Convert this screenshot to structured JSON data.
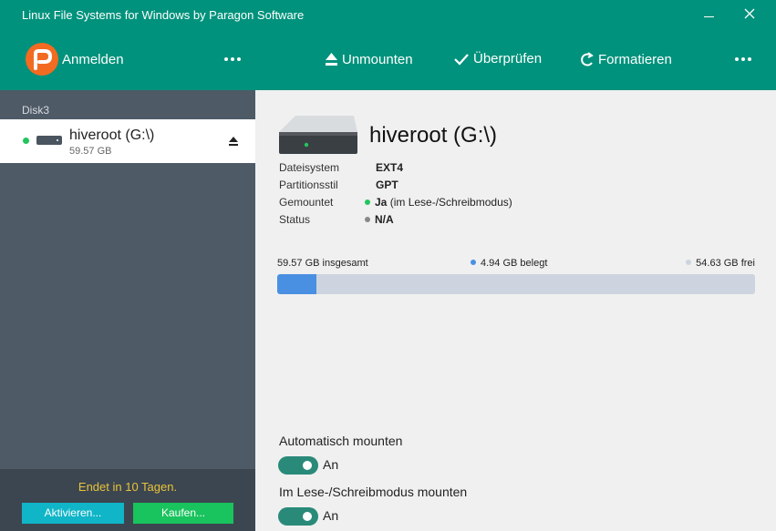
{
  "window": {
    "title": "Linux File Systems for Windows by Paragon Software"
  },
  "toolbar": {
    "login_label": "Anmelden",
    "unmount_label": "Unmounten",
    "check_label": "Überprüfen",
    "format_label": "Formatieren"
  },
  "sidebar": {
    "disk_label": "Disk3",
    "volume": {
      "name": "hiveroot (G:\\)",
      "size": "59.57 GB",
      "status_color": "#22c55e"
    },
    "expiry_text": "Endet in 10 Tagen.",
    "activate_label": "Aktivieren...",
    "buy_label": "Kaufen..."
  },
  "main": {
    "title": "hiveroot (G:\\)",
    "properties": [
      {
        "key": "Dateisystem",
        "value": "EXT4",
        "note": ""
      },
      {
        "key": "Partitionsstil",
        "value": "GPT",
        "note": ""
      },
      {
        "key": "Gemountet",
        "value": "Ja",
        "note": "(im Lese-/Schreibmodus)",
        "dot_color": "#22c55e"
      },
      {
        "key": "Status",
        "value": "N/A",
        "note": "",
        "dot_color": "#888888"
      }
    ],
    "usage": {
      "total_label": "59.57 GB insgesamt",
      "used_label": "4.94 GB belegt",
      "free_label": "54.63 GB frei",
      "used_fraction": 0.083,
      "used_color": "#4a90e2",
      "free_color": "#cdd4df"
    },
    "options": [
      {
        "label": "Automatisch mounten",
        "state": "An",
        "on": true
      },
      {
        "label": "Im Lese-/Schreibmodus mounten",
        "state": "An",
        "on": true
      }
    ]
  },
  "colors": {
    "header": "#00927c",
    "sidebar": "#4e5a66",
    "logo": "#f26b21",
    "expiry": "#e8c33a",
    "activate": "#10b5c7",
    "buy": "#19c35e"
  }
}
